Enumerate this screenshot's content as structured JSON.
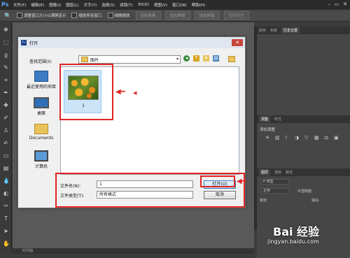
{
  "app": {
    "logo": "Ps",
    "menu": [
      "文件(F)",
      "编辑(E)",
      "图像(I)",
      "图层(L)",
      "文字(Y)",
      "选择(S)",
      "滤镜(T)",
      "3D(D)",
      "视图(V)",
      "窗口(W)",
      "帮助(H)"
    ],
    "window_controls": [
      "–",
      "▭",
      "✕"
    ]
  },
  "options_bar": {
    "checks": [
      "调整窗口大小以满屏显示",
      "缩放所有窗口",
      "细微缩放"
    ],
    "buttons": [
      "实际像素",
      "适合屏幕",
      "填充屏幕",
      "打印尺寸"
    ]
  },
  "panels": {
    "top_tabs": [
      "颜色",
      "色板",
      "历史记录"
    ],
    "adjust_tabs": [
      "调整",
      "样式"
    ],
    "adjust_title": "添加调整",
    "layers_tabs": [
      "图层",
      "通道",
      "路径"
    ],
    "layers_kind": "P 类型",
    "blend_mode": "正常",
    "opacity_label": "不透明度:",
    "lock_label": "锁定:",
    "fill_label": "填充:"
  },
  "status_bar": {
    "text": "时间轴"
  },
  "dialog": {
    "title": "打开",
    "look_in_label": "查找范围(I):",
    "look_in_value": "图片",
    "places": [
      {
        "label": "最近使用的项目",
        "icon": "recent-icon"
      },
      {
        "label": "桌面",
        "icon": "desktop-icon"
      },
      {
        "label": "Documents",
        "icon": "documents-folder-icon"
      },
      {
        "label": "计算机",
        "icon": "computer-icon"
      }
    ],
    "file": {
      "name": "1"
    },
    "filename_label": "文件名(N):",
    "filename_value": "1",
    "filetype_label": "文件类型(T):",
    "filetype_value": "所有格式",
    "open_button": "打开(O)",
    "cancel_button": "取消"
  },
  "colors": {
    "highlight": "#e02424",
    "ps_blue": "#5aa7ff"
  },
  "watermark": {
    "main": "Bai 经验",
    "sub": "jingyan.baidu.com"
  }
}
